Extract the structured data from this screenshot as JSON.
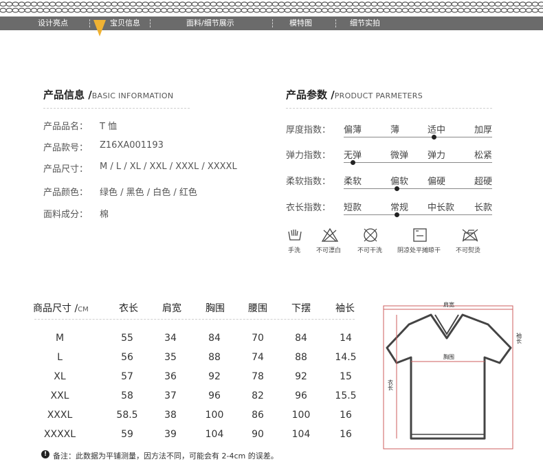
{
  "nav": {
    "items": [
      "设计亮点",
      "宝贝信息",
      "面料/细节展示",
      "模特图",
      "细节实拍"
    ]
  },
  "basic_info": {
    "title": "产品信息 /",
    "subtitle": "BASIC INFORMATION",
    "rows": [
      {
        "label": "产品品名：",
        "value": "T 恤"
      },
      {
        "label": "产品款号：",
        "value": "Z16XA001193"
      },
      {
        "label": "产品尺寸：",
        "value": "M / L / XL / XXL / XXXL / XXXXL"
      },
      {
        "label": "产品颜色：",
        "value": "绿色 / 黑色 / 白色 / 红色"
      },
      {
        "label": "面料成分：",
        "value": "棉"
      }
    ]
  },
  "product_params": {
    "title": "产品参数 /",
    "subtitle": "PRODUCT PARMETERS",
    "rows": [
      {
        "label": "厚度指数：",
        "options": [
          "偏薄",
          "薄",
          "适中",
          "加厚"
        ],
        "selected": 2
      },
      {
        "label": "弹力指数：",
        "options": [
          "无弹",
          "微弹",
          "弹力",
          "松紧"
        ],
        "selected": 0
      },
      {
        "label": "柔软指数：",
        "options": [
          "柔软",
          "偏软",
          "偏硬",
          "超硬"
        ],
        "selected": 1
      },
      {
        "label": "衣长指数：",
        "options": [
          "短款",
          "常规",
          "中长款",
          "长款"
        ],
        "selected": 1
      }
    ]
  },
  "care": [
    {
      "icon": "hand-wash-icon",
      "label": "手洗"
    },
    {
      "icon": "no-bleach-icon",
      "label": "不可漂白"
    },
    {
      "icon": "no-dry-clean-icon",
      "label": "不可干洗"
    },
    {
      "icon": "dry-flat-shade-icon",
      "label": "阴凉处平摊晾干"
    },
    {
      "icon": "no-iron-icon",
      "label": "不可熨烫"
    }
  ],
  "size_table": {
    "headers": [
      "商品尺寸 /",
      "衣长",
      "肩宽",
      "胸围",
      "腰围",
      "下摆",
      "袖长"
    ],
    "unit": "CM",
    "rows": [
      [
        "M",
        "55",
        "34",
        "84",
        "70",
        "84",
        "14"
      ],
      [
        "L",
        "56",
        "35",
        "88",
        "74",
        "88",
        "14.5"
      ],
      [
        "XL",
        "57",
        "36",
        "92",
        "78",
        "92",
        "15"
      ],
      [
        "XXL",
        "58",
        "37",
        "96",
        "82",
        "96",
        "15.5"
      ],
      [
        "XXXL",
        "58.5",
        "38",
        "100",
        "86",
        "100",
        "16"
      ],
      [
        "XXXXL",
        "59",
        "39",
        "104",
        "90",
        "104",
        "16"
      ]
    ]
  },
  "note": {
    "icon": "!",
    "text": "备注：此数据为平铺测量，因方法不同，可能会有 2-4cm 的误差。"
  },
  "diagram": {
    "shoulder": "肩宽",
    "chest": "胸围",
    "length": "衣长",
    "sleeve": "袖长",
    "accent_color": "#d9534f"
  }
}
